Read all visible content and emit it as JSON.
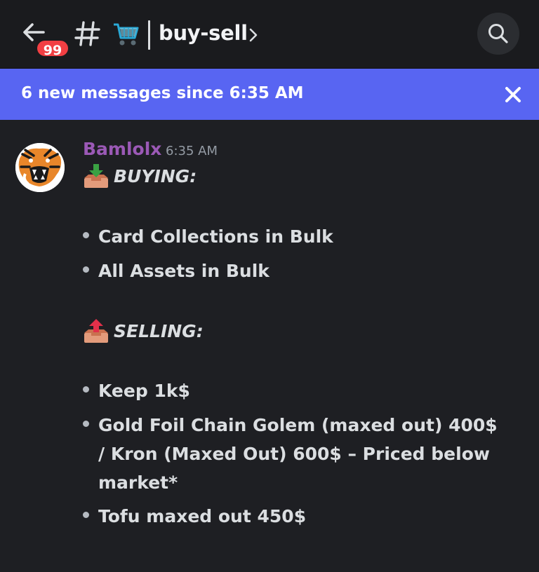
{
  "header": {
    "unread_badge": "99",
    "channel_name": "buy-sell"
  },
  "banner": {
    "text": "6 new messages since 6:35 AM"
  },
  "message": {
    "author": "Bamlolx",
    "time": "6:35 AM",
    "buying": {
      "label": "BUYING:",
      "items": [
        "Card Collections in Bulk",
        "All Assets in Bulk"
      ]
    },
    "selling": {
      "label": "SELLING:",
      "items": [
        "Keep 1k$",
        "Gold Foil Chain Golem (maxed out) 400$ / Kron (Maxed Out) 600$ – Priced below market*",
        "Tofu maxed out 450$"
      ]
    }
  },
  "colors": {
    "banner": "#5865f2",
    "username": "#9b59b6",
    "badge": "#f23f43",
    "background": "#1e1f23"
  },
  "icons": {
    "back": "arrow-left-icon",
    "channel": "hash-icon",
    "cart": "shopping-cart-emoji",
    "search": "search-icon",
    "close": "close-icon",
    "inbox_down": "inbox-tray-emoji",
    "inbox_up": "outbox-tray-emoji"
  }
}
